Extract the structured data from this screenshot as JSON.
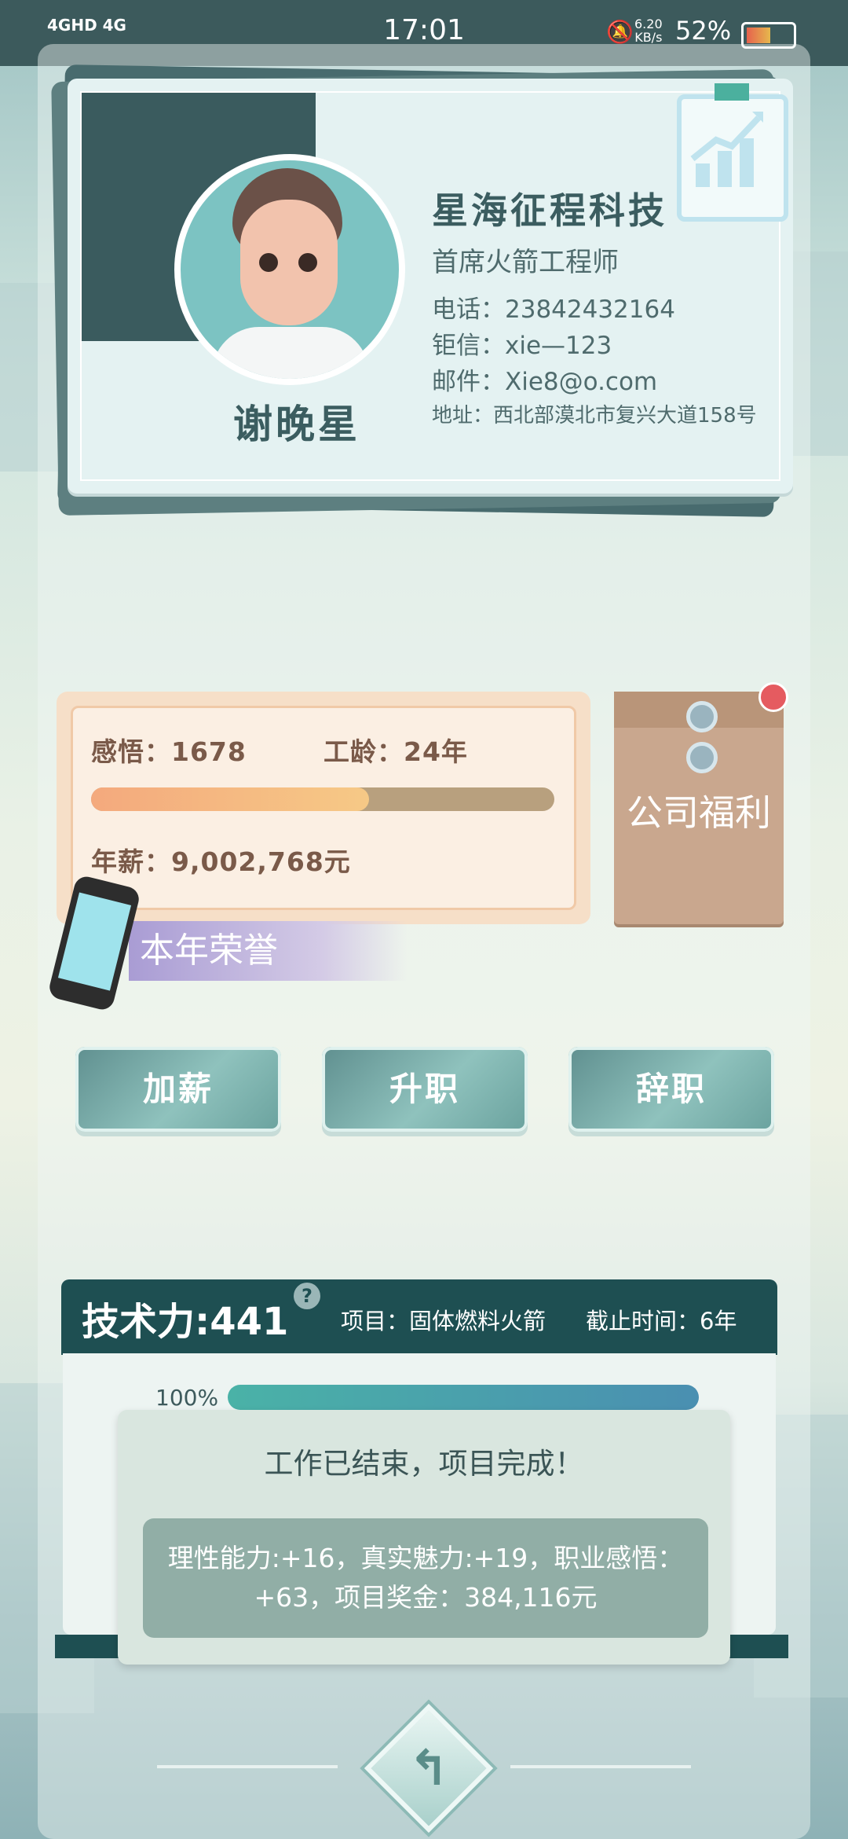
{
  "status_bar": {
    "network": "4GHD 4G",
    "time": "17:01",
    "speed": "6.20\nKB/s",
    "battery": "52%"
  },
  "card": {
    "name": "谢晚星",
    "company": "星海征程科技",
    "title": "首席火箭工程师",
    "phone": "电话：23842432164",
    "wechat": "钜信：xie—123",
    "email": "邮件：Xie8@o.com",
    "address": "地址：西北部漠北市复兴大道158号"
  },
  "stats": {
    "insight": "感悟：1678",
    "seniority": "工龄：24年",
    "salary": "年薪：9,002,768元",
    "progress": 0.6,
    "honor_label": "本年荣誉"
  },
  "benefits": {
    "label": "公司福利"
  },
  "actions": {
    "raise": "加薪",
    "promote": "升职",
    "resign": "辞职"
  },
  "tech": {
    "power": "技术力:441",
    "help": "?",
    "project": "项目：固体燃料火箭",
    "deadline": "截止时间：6年",
    "percent": "100%",
    "progress": 1.0
  },
  "dialog": {
    "message": "工作已结束，项目完成！",
    "rewards_line1": "理性能力:+16，真实魅力:+19，职业感悟：",
    "rewards_line2": "+63，项目奖金：384,116元"
  },
  "icons": {
    "back": "back-arrow-icon",
    "chart": "growth-chart-icon",
    "phone": "phone-icon"
  }
}
